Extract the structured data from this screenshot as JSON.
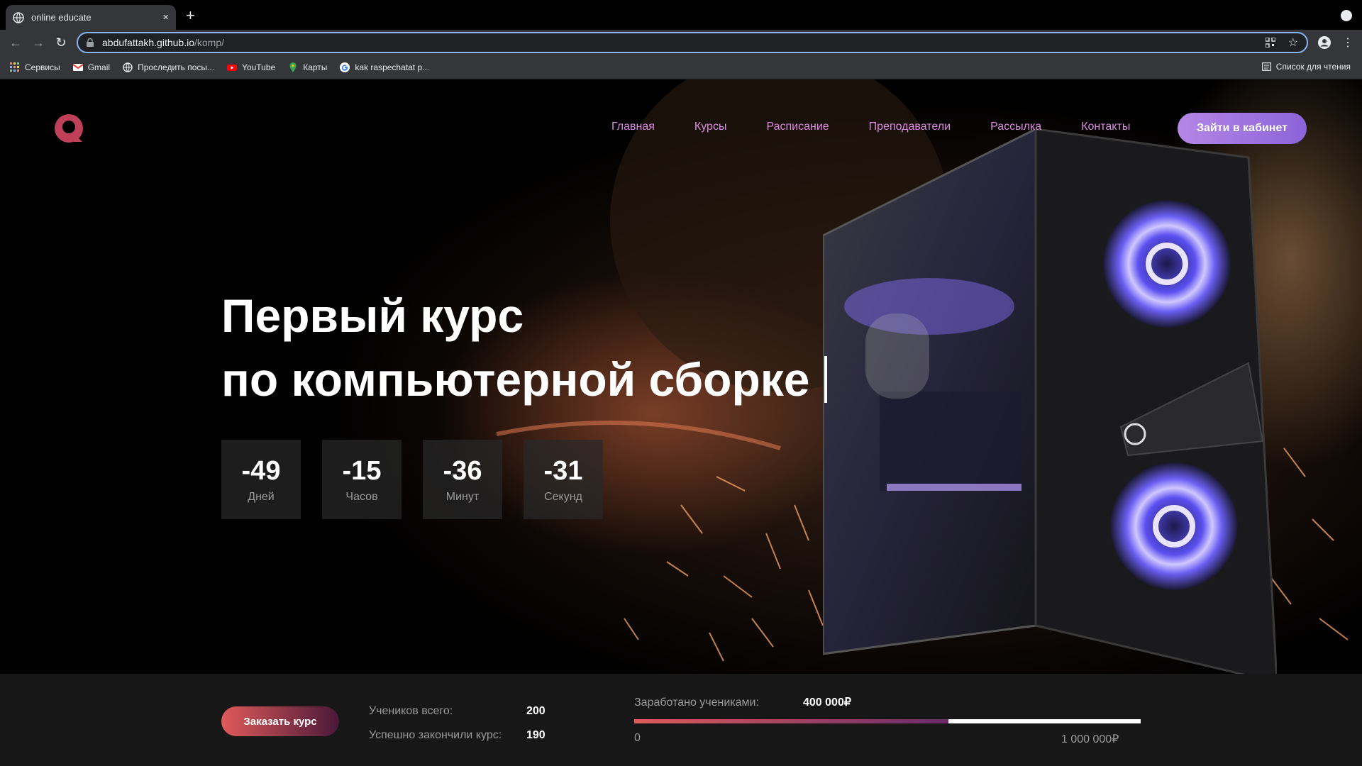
{
  "browser": {
    "tab_title": "online educate",
    "tab_close": "×",
    "new_tab": "+",
    "url_host": "abdufattakh.github.io",
    "url_path": "/komp/",
    "bookmarks": [
      "Сервисы",
      "Gmail",
      "Проследить посы...",
      "YouTube",
      "Карты",
      "kak raspechatat p..."
    ],
    "reading_list": "Список для чтения"
  },
  "site": {
    "nav": [
      "Главная",
      "Курсы",
      "Расписание",
      "Преподаватели",
      "Рассылка",
      "Контакты"
    ],
    "cabinet_button": "Зайти в кабинет",
    "headline_line1": "Первый курс",
    "headline_line2": "по компьютерной сборке",
    "countdown": [
      {
        "value": "-49",
        "label": "Дней"
      },
      {
        "value": "-15",
        "label": "Часов"
      },
      {
        "value": "-36",
        "label": "Минут"
      },
      {
        "value": "-31",
        "label": "Секунд"
      }
    ],
    "order_button": "Заказать курс",
    "students_total_label": "Учеников всего:",
    "students_total_value": "200",
    "students_finished_label": "Успешно закончили курс:",
    "students_finished_value": "190",
    "earned_label": "Заработано учениками:",
    "earned_value": "400 000₽",
    "progress_min": "0",
    "progress_max": "1 000 000₽",
    "progress_fraction": 0.62
  },
  "colors": {
    "nav_link": "#d98ce0",
    "accent_purple": "#b486e6",
    "accent_red": "#e05a5a",
    "logo": "#c0405a"
  }
}
